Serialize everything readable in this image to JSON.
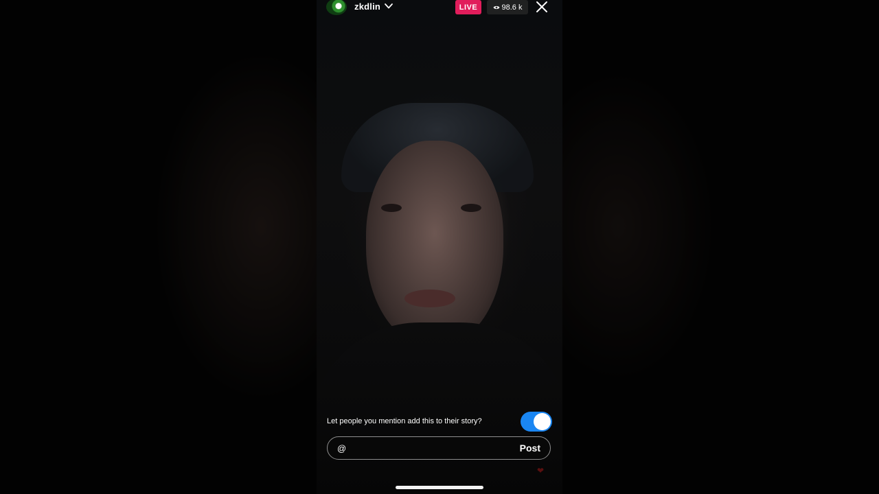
{
  "header": {
    "username": "zkdlin",
    "live_label": "LIVE",
    "viewer_count": "98.6 k",
    "icons": {
      "avatar": "profile-avatar",
      "chevron": "chevron-down-icon",
      "viewers": "eye-icon",
      "close": "close-icon"
    }
  },
  "footer": {
    "mention_prompt": "Let people you mention add this to their story?",
    "mention_toggle_on": true,
    "comment_prefix": "@",
    "comment_value": "",
    "post_label": "Post"
  },
  "colors": {
    "live_badge": "#e11d5b",
    "toggle_on": "#1a86f2",
    "background": "#000000"
  }
}
